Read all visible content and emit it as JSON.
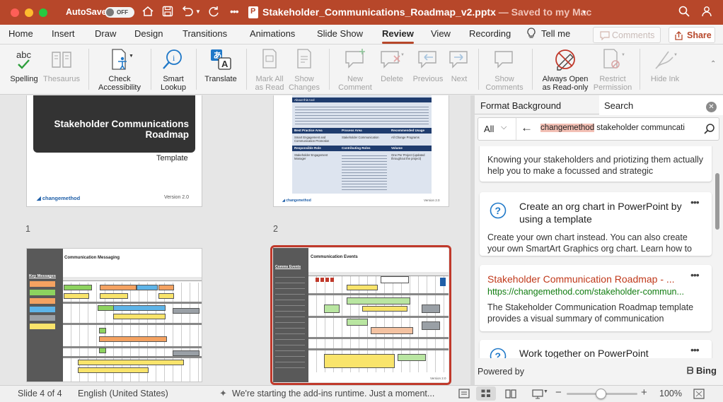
{
  "titlebar": {
    "autosave_label": "AutoSave",
    "toggle_state": "OFF",
    "doc_title": "Stakeholder_Communications_Roadmap_v2.pptx",
    "save_status": "— Saved to my Mac"
  },
  "tabs": [
    "Home",
    "Insert",
    "Draw",
    "Design",
    "Transitions",
    "Animations",
    "Slide Show",
    "Review",
    "View",
    "Recording"
  ],
  "tell_me": "Tell me",
  "comments_btn": "Comments",
  "share_btn": "Share",
  "ribbon": {
    "spelling": "Spelling",
    "thesaurus": "Thesaurus",
    "check1": "Check",
    "check2": "Accessibility",
    "smart1": "Smart",
    "smart2": "Lookup",
    "translate": "Translate",
    "markall1": "Mark All",
    "markall2": "as Read",
    "showch1": "Show",
    "showch2": "Changes",
    "newc1": "New",
    "newc2": "Comment",
    "delete": "Delete",
    "previous": "Previous",
    "next": "Next",
    "showcm1": "Show",
    "showcm2": "Comments",
    "always1": "Always Open",
    "always2": "as Read-only",
    "restrict1": "Restrict",
    "restrict2": "Permission",
    "hideink": "Hide Ink"
  },
  "slides": {
    "s1": {
      "title1": "Stakeholder Communications",
      "title2": "Roadmap",
      "template": "Template",
      "logo": "changemethod",
      "version": "Version 2.0",
      "number": "1"
    },
    "s2": {
      "about": "About this tool",
      "h1": "Best Practice Area",
      "h2": "Process Area",
      "h3": "Recommended Usage",
      "c1": "Smart Engagement and Communication Promotion",
      "c2": "Stakeholder Communication",
      "c3": "All Change Programs",
      "h4": "Responsible Role",
      "h5": "Contributing Roles",
      "h6": "Volume",
      "c4": "Stakeholder Engagement Manager",
      "c6": "One Per Project (updated throughout the project)",
      "logo": "changemethod",
      "version": "Version 2.0",
      "number": "2"
    },
    "s3": {
      "title": "Communication Messaging",
      "key": "Key Messages"
    },
    "s4": {
      "title": "Communication Events",
      "key": "Comms Events",
      "version": "Version 2.0"
    }
  },
  "pane": {
    "tab1": "Format Background",
    "tab2": "Search",
    "scope": "All",
    "query_highlight": "changemethod",
    "query_rest": " stakeholder communcati",
    "results": [
      {
        "body": "Knowing your stakeholders and priotizing them actually help you to make a focussed and strategic"
      },
      {
        "title": "Create an org chart in PowerPoint by using a template",
        "body": "Create your own chart instead. You can also create your own SmartArt Graphics org chart. Learn how to"
      },
      {
        "title": "Stakeholder Communication Roadmap - ...",
        "url": "https://changemethod.com/stakeholder-commun...",
        "body": "The Stakeholder Communication Roadmap template provides a visual summary of communication"
      },
      {
        "title": "Work together on PowerPoint"
      }
    ],
    "powered": "Powered by",
    "bing": "Bing"
  },
  "status": {
    "slide": "Slide 4 of 4",
    "lang": "English (United States)",
    "addins": "We're starting the add-ins runtime. Just a moment...",
    "zoom": "100%"
  },
  "colors": {
    "accent": "#b7472a",
    "link": "#c0391b",
    "url": "#107c10",
    "search_hl": "#f3c0b5"
  }
}
